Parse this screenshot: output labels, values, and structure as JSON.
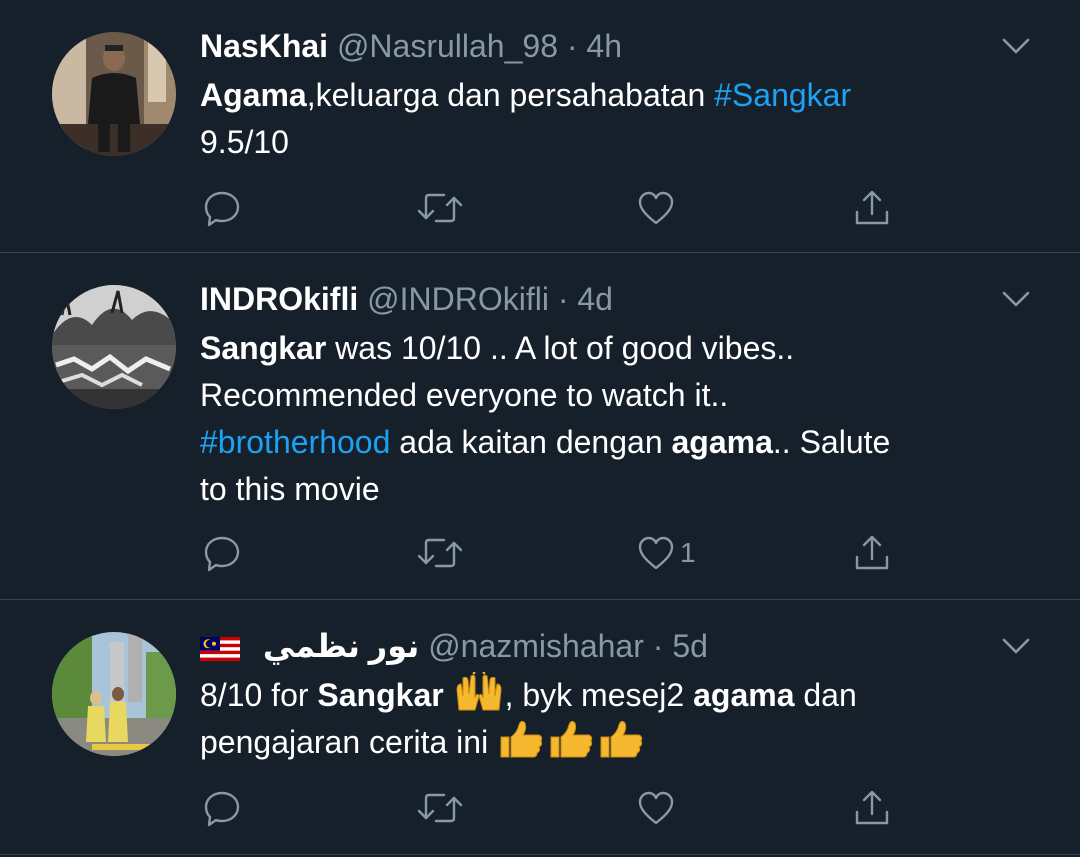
{
  "tweets": [
    {
      "name": "NasKhai",
      "handle": "@Nasrullah_98",
      "separator": "·",
      "time": "4h",
      "text": {
        "b1": "Agama",
        "t1": ",keluarga dan persahabatan ",
        "h1": "#Sangkar",
        "t2": "9.5/10"
      },
      "like_count": ""
    },
    {
      "name": "INDROkifli",
      "handle": "@INDROkifli",
      "separator": "·",
      "time": "4d",
      "text": {
        "b1": "Sangkar",
        "t1": " was 10/10 .. A lot of good vibes..",
        "t2": "Recommended everyone to watch it..",
        "h1": "#brotherhood",
        "t3": " ada kaitan dengan ",
        "b2": "agama",
        "t4": "..  Salute",
        "t5": "to this movie"
      },
      "like_count": "1"
    },
    {
      "name": "نور نظمي",
      "handle": "@nazmishahar",
      "separator": "·",
      "time": "5d",
      "text": {
        "t1": "8/10 for ",
        "b1": "Sangkar",
        "t2": ", byk mesej2 ",
        "b2": "agama",
        "t3": " dan",
        "t4": "pengajaran cerita ini "
      },
      "like_count": ""
    }
  ],
  "colors": {
    "background": "#15202b",
    "divider": "#38444d",
    "text": "#ffffff",
    "secondary": "#8899a6",
    "link": "#1da1f2"
  },
  "icons": [
    "reply-icon",
    "retweet-icon",
    "like-icon",
    "share-icon",
    "chevron-down-icon",
    "malaysia-flag-icon",
    "raising-hands-emoji",
    "thumbs-up-emoji"
  ]
}
